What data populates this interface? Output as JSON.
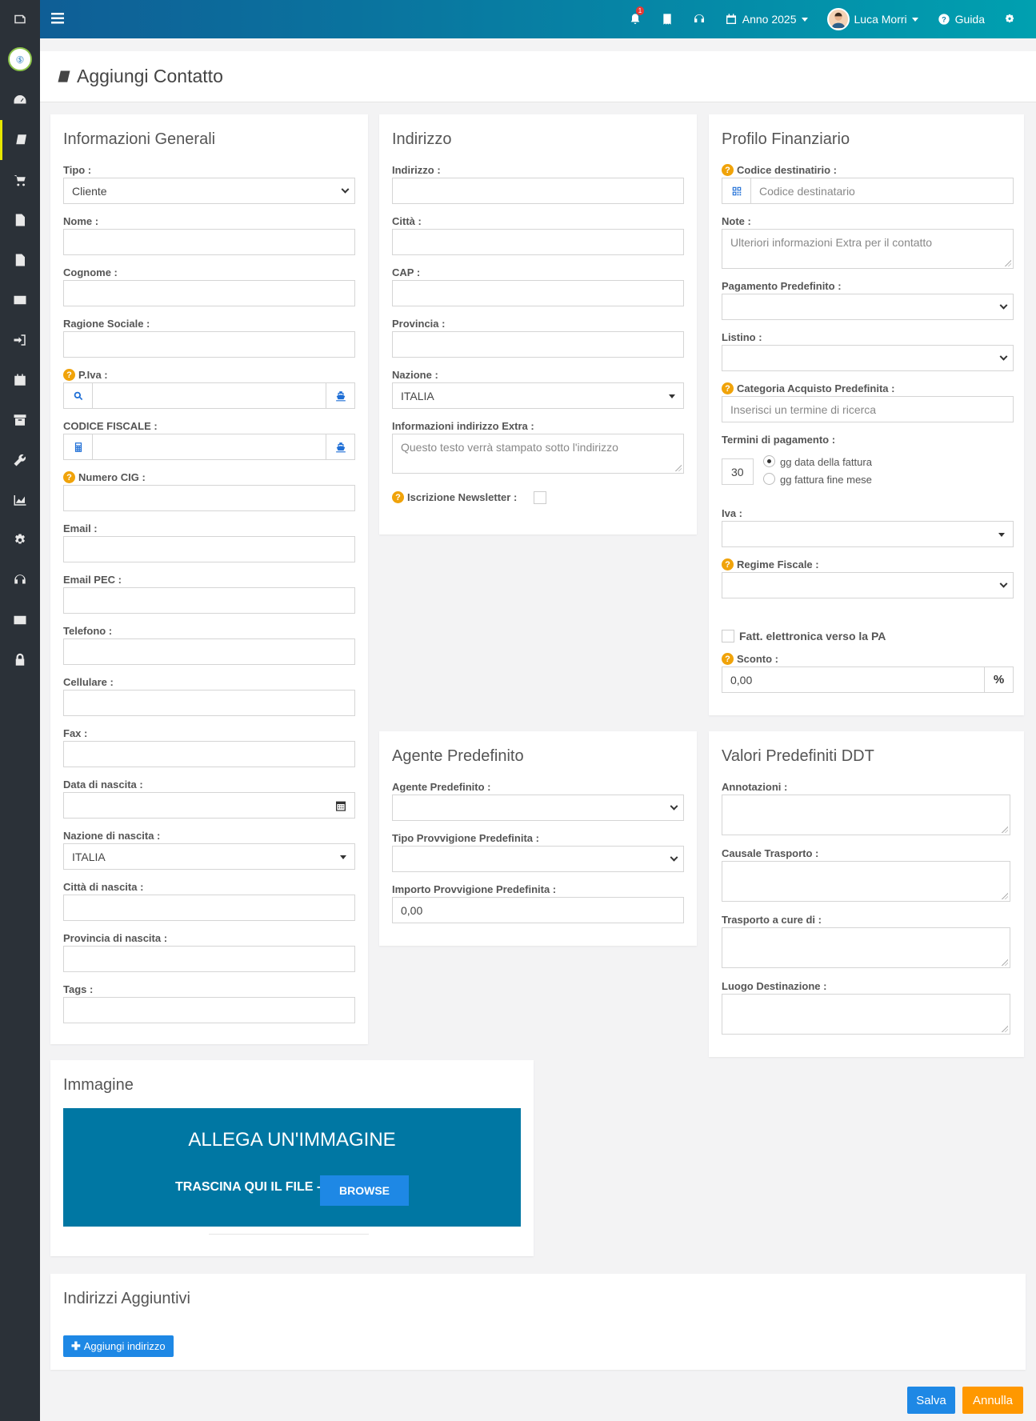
{
  "topbar": {
    "notifications_count": "1",
    "year": "Anno 2025",
    "user": "Luca Morri",
    "help": "Guida"
  },
  "page": {
    "title": "Aggiungi Contatto"
  },
  "general": {
    "title": "Informazioni Generali",
    "tipo_label": "Tipo :",
    "tipo_value": "Cliente",
    "nome_label": "Nome :",
    "cognome_label": "Cognome :",
    "ragione_label": "Ragione Sociale :",
    "piva_label": "P.Iva :",
    "cf_label": "CODICE FISCALE :",
    "cig_label": "Numero CIG :",
    "email_label": "Email :",
    "pec_label": "Email PEC :",
    "telefono_label": "Telefono :",
    "cellulare_label": "Cellulare :",
    "fax_label": "Fax :",
    "nascita_label": "Data di nascita :",
    "nazione_nascita_label": "Nazione di nascita :",
    "nazione_nascita_value": "ITALIA",
    "citta_nascita_label": "Città di nascita :",
    "provincia_nascita_label": "Provincia di nascita :",
    "tags_label": "Tags :"
  },
  "address": {
    "title": "Indirizzo",
    "indirizzo_label": "Indirizzo :",
    "citta_label": "Città :",
    "cap_label": "CAP :",
    "provincia_label": "Provincia :",
    "nazione_label": "Nazione :",
    "nazione_value": "ITALIA",
    "extra_label": "Informazioni indirizzo Extra :",
    "extra_placeholder": "Questo testo verrà stampato sotto l'indirizzo",
    "newsletter_label": "Iscrizione Newsletter :"
  },
  "finance": {
    "title": "Profilo Finanziario",
    "codice_label": "Codice destinatirio :",
    "codice_placeholder": "Codice destinatario",
    "note_label": "Note :",
    "note_placeholder": "Ulteriori informazioni Extra per il contatto",
    "pagamento_label": "Pagamento Predefinito :",
    "listino_label": "Listino :",
    "categoria_label": "Categoria Acquisto Predefinita :",
    "categoria_placeholder": "Inserisci un termine di ricerca",
    "termini_label": "Termini di pagamento :",
    "termini_value": "30",
    "radio1": "gg data della fattura",
    "radio2": "gg fattura fine mese",
    "iva_label": "Iva :",
    "regime_label": "Regime Fiscale :",
    "pa_label": "Fatt. elettronica verso la PA",
    "sconto_label": "Sconto :",
    "sconto_value": "0,00",
    "sconto_unit": "%"
  },
  "agent": {
    "title": "Agente Predefinito",
    "agente_label": "Agente Predefinito :",
    "tipo_label": "Tipo Provvigione Predefinita :",
    "importo_label": "Importo Provvigione Predefinita :",
    "importo_value": "0,00"
  },
  "ddt": {
    "title": "Valori Predefiniti DDT",
    "annotazioni_label": "Annotazioni :",
    "causale_label": "Causale Trasporto :",
    "trasporto_label": "Trasporto a cure di :",
    "luogo_label": "Luogo Destinazione :"
  },
  "image": {
    "title": "Immagine",
    "drop_title": "ALLEGA UN'IMMAGINE",
    "drop_text": "TRASCINA QUI IL FILE -",
    "browse": "BROWSE"
  },
  "extra_addresses": {
    "title": "Indirizzi Aggiuntivi",
    "add_button": "Aggiungi indirizzo"
  },
  "actions": {
    "save": "Salva",
    "cancel": "Annulla"
  },
  "colors": {
    "save": "#1e88e5",
    "cancel": "#ff9800",
    "dropzone": "#0077a3",
    "sidebar": "#2b3138"
  }
}
